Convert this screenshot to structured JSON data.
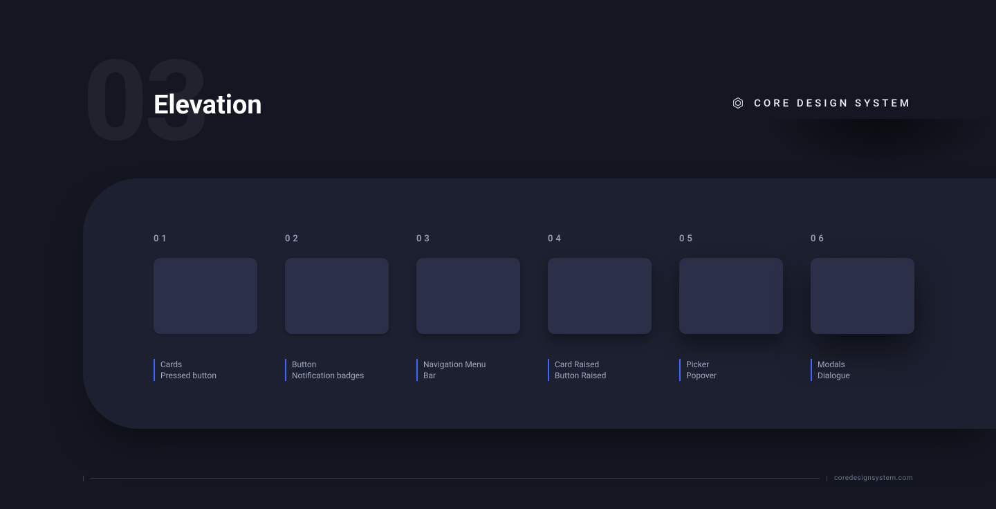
{
  "header": {
    "big_number": "03",
    "title": "Elevation"
  },
  "brand": {
    "label": "CORE DESIGN SYSTEM"
  },
  "levels": [
    {
      "num": "01",
      "line1": "Cards",
      "line2": "Pressed button"
    },
    {
      "num": "02",
      "line1": "Button",
      "line2": "Notification badges"
    },
    {
      "num": "03",
      "line1": "Navigation Menu",
      "line2": "Bar"
    },
    {
      "num": "04",
      "line1": "Card Raised",
      "line2": "Button Raised"
    },
    {
      "num": "05",
      "line1": "Picker",
      "line2": "Popover"
    },
    {
      "num": "06",
      "line1": "Modals",
      "line2": "Dialogue"
    }
  ],
  "footer": {
    "url": "coredesignsystem.com"
  }
}
